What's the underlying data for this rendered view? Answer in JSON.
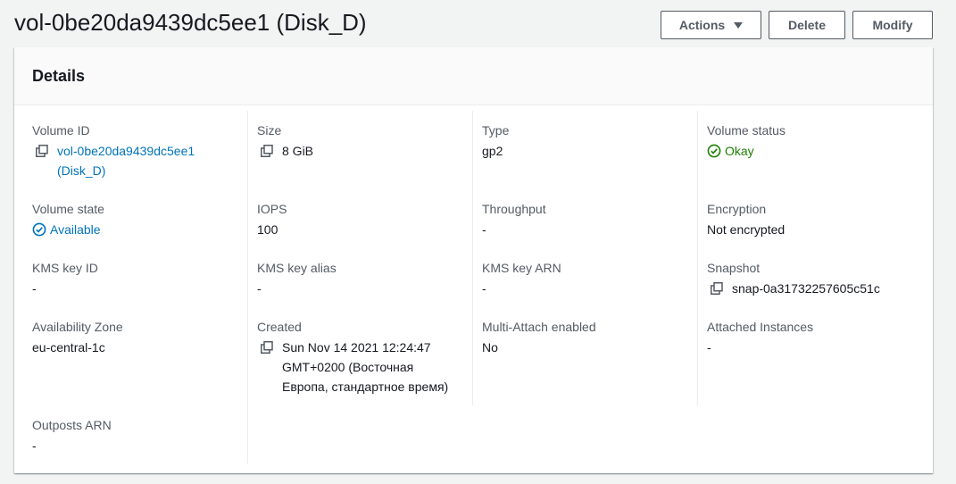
{
  "header": {
    "title": "vol-0be20da9439dc5ee1 (Disk_D)",
    "actions_label": "Actions",
    "delete_label": "Delete",
    "modify_label": "Modify"
  },
  "details": {
    "title": "Details",
    "volume_id": {
      "label": "Volume ID",
      "value": "vol-0be20da9439dc5ee1 (Disk_D)"
    },
    "size": {
      "label": "Size",
      "value": "8 GiB"
    },
    "type": {
      "label": "Type",
      "value": "gp2"
    },
    "volume_status": {
      "label": "Volume status",
      "value": "Okay"
    },
    "volume_state": {
      "label": "Volume state",
      "value": "Available"
    },
    "iops": {
      "label": "IOPS",
      "value": "100"
    },
    "throughput": {
      "label": "Throughput",
      "value": "-"
    },
    "encryption": {
      "label": "Encryption",
      "value": "Not encrypted"
    },
    "kms_key_id": {
      "label": "KMS key ID",
      "value": "-"
    },
    "kms_key_alias": {
      "label": "KMS key alias",
      "value": "-"
    },
    "kms_key_arn": {
      "label": "KMS key ARN",
      "value": "-"
    },
    "snapshot": {
      "label": "Snapshot",
      "value": "snap-0a31732257605c51c"
    },
    "availability_zone": {
      "label": "Availability Zone",
      "value": "eu-central-1c"
    },
    "created": {
      "label": "Created",
      "value": "Sun Nov 14 2021 12:24:47 GMT+0200 (Восточная Европа, стандартное время)"
    },
    "multi_attach": {
      "label": "Multi-Attach enabled",
      "value": "No"
    },
    "attached_instances": {
      "label": "Attached Instances",
      "value": "-"
    },
    "outposts_arn": {
      "label": "Outposts ARN",
      "value": "-"
    }
  },
  "colors": {
    "link": "#0073bb",
    "success": "#1d8102",
    "label": "#545b64"
  },
  "icons": {
    "copy": "copy-icon",
    "status_ok": "check-circle-icon",
    "status_available": "check-circle-outline-icon"
  }
}
